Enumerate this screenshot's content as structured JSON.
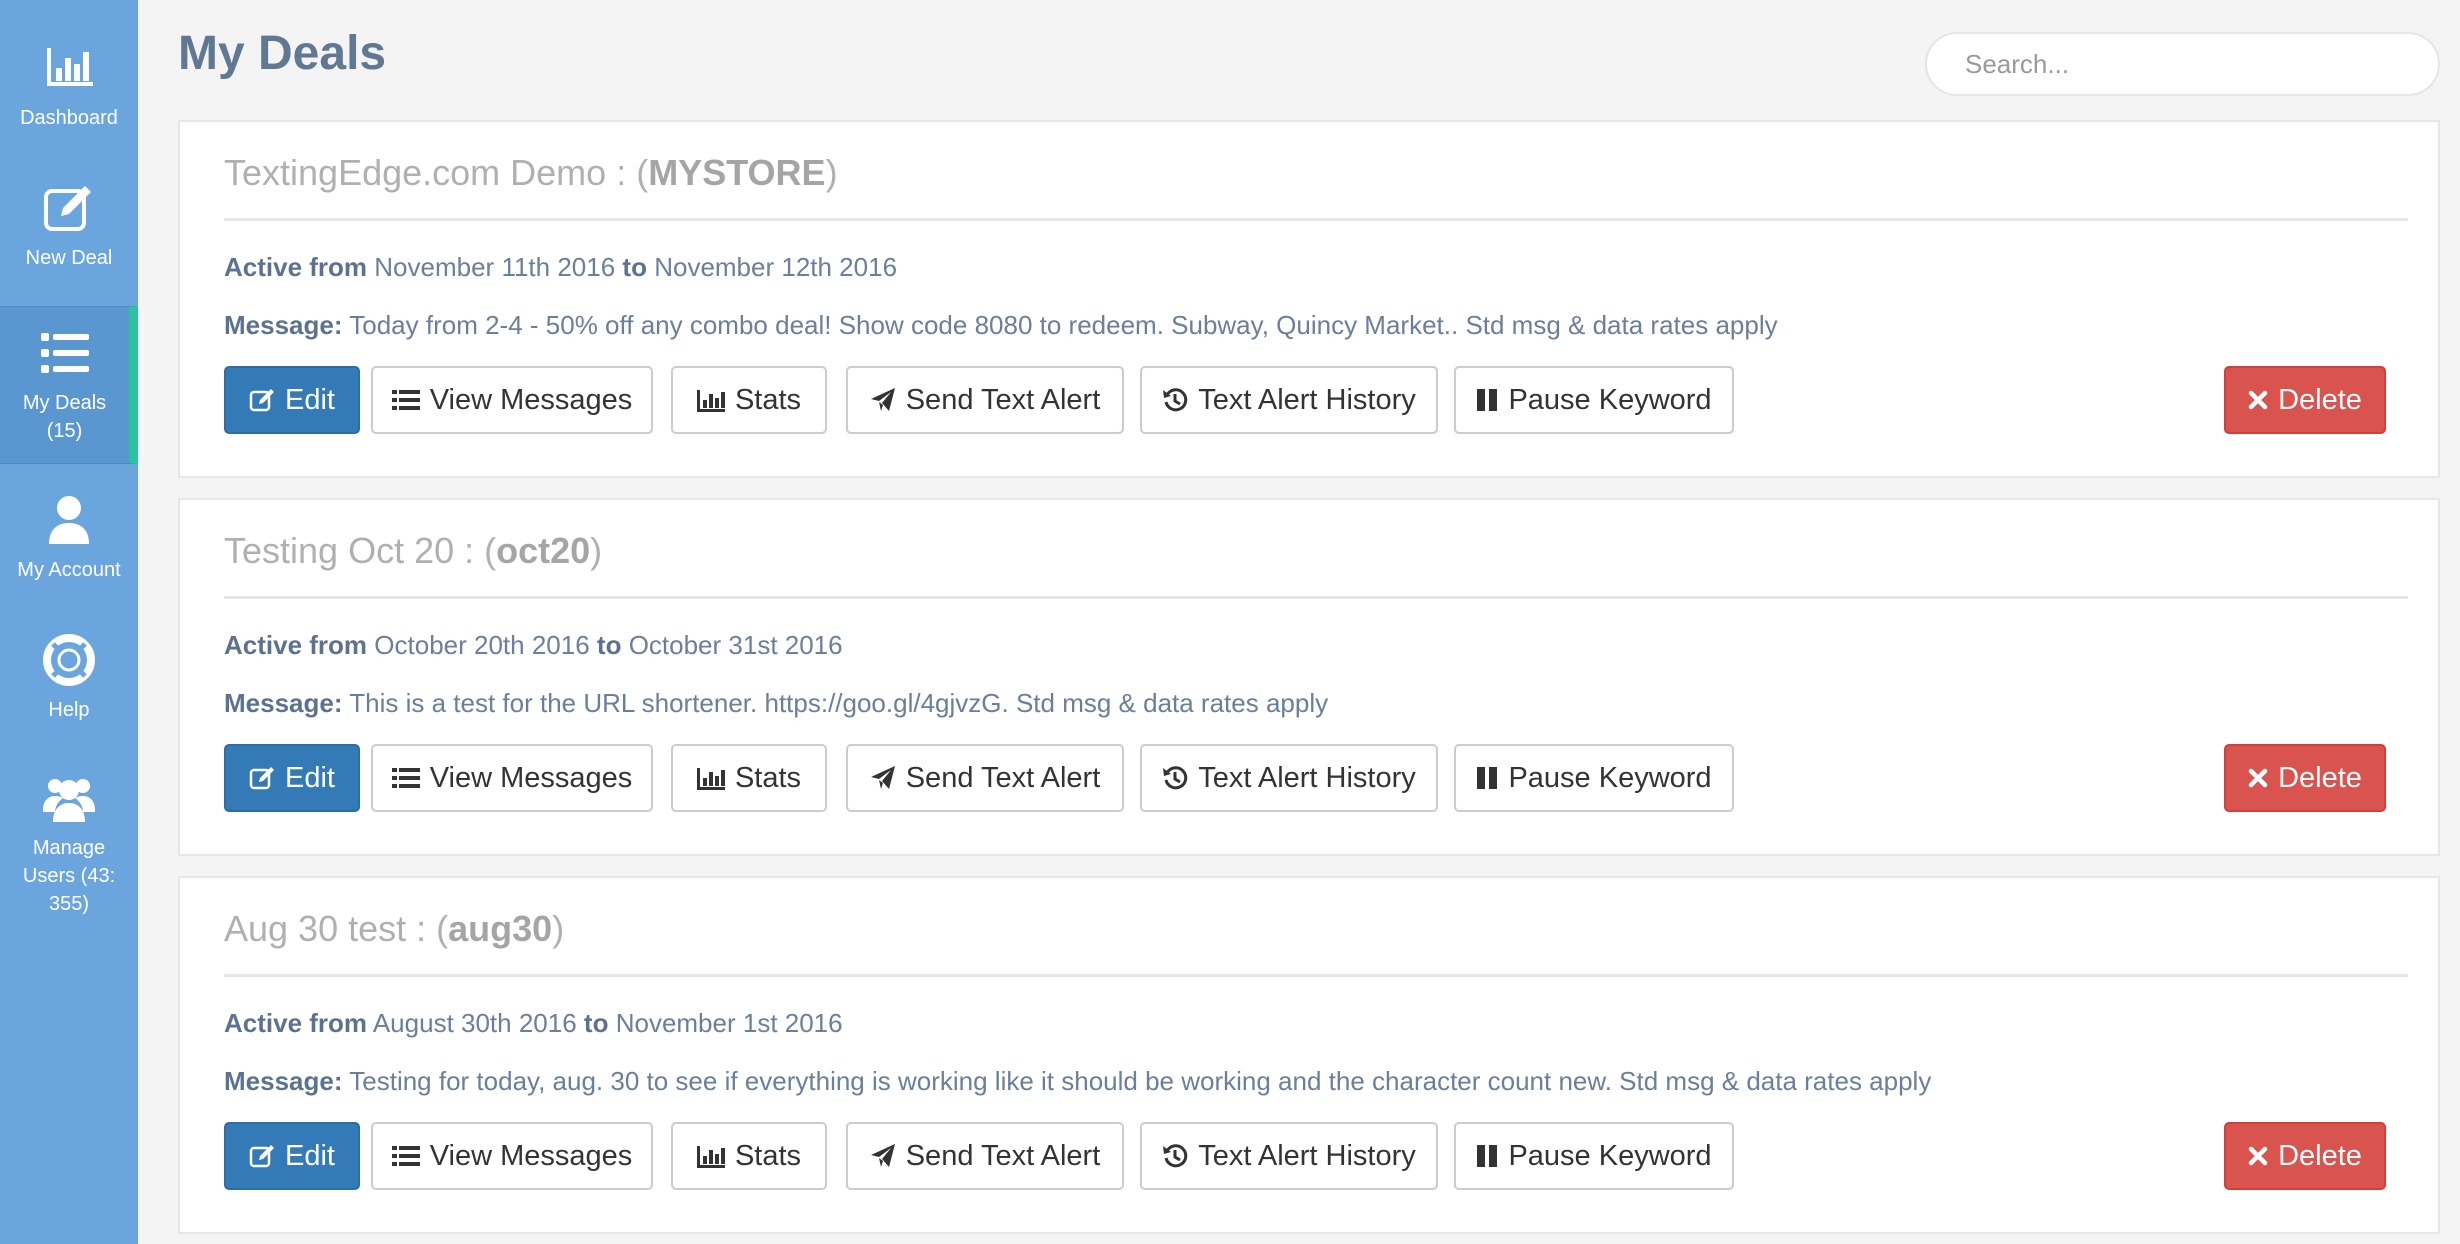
{
  "sidebar": {
    "items": [
      {
        "label": "Dashboard",
        "icon": "bar-chart-icon"
      },
      {
        "label": "New Deal",
        "icon": "edit-icon"
      },
      {
        "label": "My Deals (15)",
        "icon": "list-icon",
        "active": true
      },
      {
        "label": "My Account",
        "icon": "user-icon"
      },
      {
        "label": "Help",
        "icon": "lifebuoy-icon"
      },
      {
        "label": "Manage Users (43: 355)",
        "icon": "users-icon"
      }
    ]
  },
  "header": {
    "title": "My Deals",
    "search_placeholder": "Search..."
  },
  "labels": {
    "active_from": "Active from",
    "to": "to",
    "message": "Message:"
  },
  "buttons": {
    "edit": "Edit",
    "view_messages": "View Messages",
    "stats": "Stats",
    "send_text_alert": "Send Text Alert",
    "text_alert_history": "Text Alert History",
    "pause_keyword": "Pause Keyword",
    "delete": "Delete"
  },
  "deals": [
    {
      "name": "TextingEdge.com Demo",
      "keyword": "MYSTORE",
      "start": "November 11th 2016",
      "end": "November 12th 2016",
      "message": "Today from 2-4 - 50% off any combo deal! Show code 8080 to redeem. Subway, Quincy Market.. Std msg & data rates apply"
    },
    {
      "name": "Testing Oct 20",
      "keyword": "oct20",
      "start": "October 20th 2016",
      "end": "October 31st 2016",
      "message": "This is a test for the URL shortener. https://goo.gl/4gjvzG. Std msg & data rates apply"
    },
    {
      "name": "Aug 30 test",
      "keyword": "aug30",
      "start": "August 30th 2016",
      "end": "November 1st 2016",
      "message": "Testing for today, aug. 30 to see if everything is working like it should be working and the character count new. Std msg & data rates apply"
    }
  ],
  "colors": {
    "sidebar": "#6aa6dd",
    "active_indicator": "#2dc3a0",
    "primary": "#337ab7",
    "danger": "#d9534f"
  }
}
